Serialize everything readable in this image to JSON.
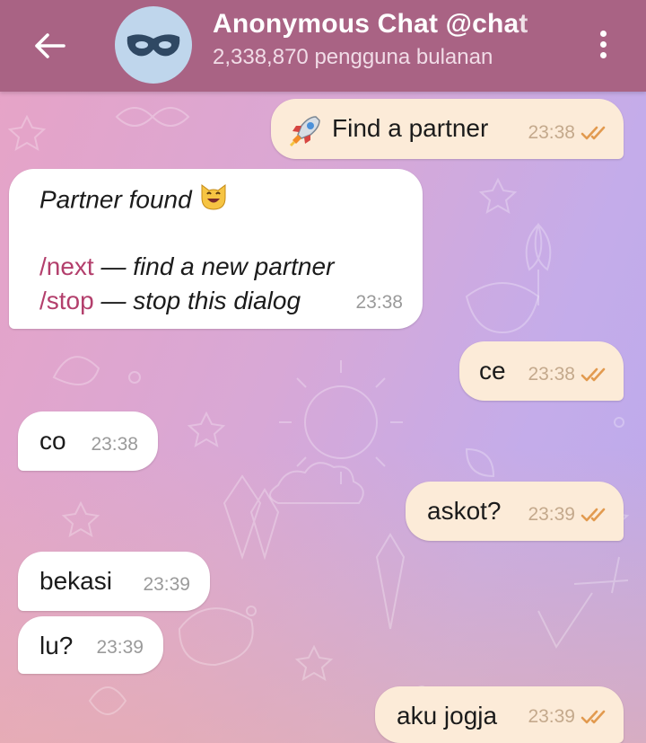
{
  "header": {
    "title": "Anonymous Chat @chat",
    "subtitle": "2,338,870 pengguna bulanan"
  },
  "messages": [
    {
      "direction": "out",
      "text": "Find a partner",
      "time": "23:38",
      "status": "read",
      "emoji": "rocket"
    },
    {
      "direction": "in",
      "title": "Partner found",
      "title_emoji": "smiling-cat",
      "next_cmd": "/next",
      "next_desc": " — find a new partner",
      "stop_cmd": "/stop",
      "stop_desc": " — stop this dialog",
      "time": "23:38"
    },
    {
      "direction": "out",
      "text": "ce",
      "time": "23:38",
      "status": "read"
    },
    {
      "direction": "in",
      "text": "co",
      "time": "23:38"
    },
    {
      "direction": "out",
      "text": "askot?",
      "time": "23:39",
      "status": "read"
    },
    {
      "direction": "in",
      "text": "bekasi",
      "time": "23:39"
    },
    {
      "direction": "in",
      "text": "lu?",
      "time": "23:39"
    },
    {
      "direction": "out",
      "text": "aku jogja",
      "time": "23:39",
      "status": "read"
    }
  ],
  "colors": {
    "header": "#a96384",
    "outgoing_bubble": "#fcebd8",
    "incoming_bubble": "#ffffff",
    "command_link": "#b33f6c",
    "read_ticks": "#e29a4f"
  }
}
